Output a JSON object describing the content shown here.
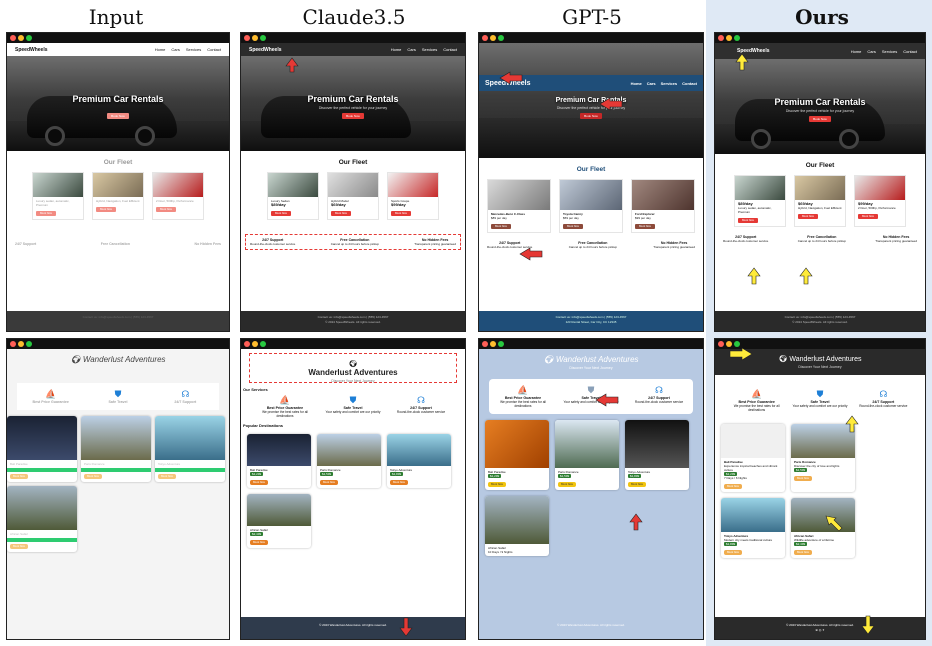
{
  "columns": [
    "Input",
    "Claude3.5",
    "GPT-5",
    "Ours"
  ],
  "car_site": {
    "brand": "SpeedWheels",
    "nav": [
      "Home",
      "Cars",
      "Services",
      "Contact"
    ],
    "hero_title": "Premium Car Rentals",
    "hero_sub": "Discover the perfect vehicle for your journey",
    "hero_cta": "Book Now",
    "fleet_title": "Our Fleet",
    "cars": [
      {
        "name": "Luxury Sedan",
        "price": "$89/day",
        "desc": "Luxury sedan, automatic, Premium",
        "button": "Book Now"
      },
      {
        "name": "Hybrid Model",
        "price": "$69/day",
        "desc": "Hybrid, Navigation, Fuel Efficient",
        "button": "Book Now"
      },
      {
        "name": "Sports Coupe",
        "price": "$99/day",
        "desc": "2 Door, 500hp, Performance",
        "button": "Book Now"
      }
    ],
    "gpt_cars": [
      {
        "name": "Mercedes-Benz C-Class",
        "price": "$89 per day",
        "desc": "Luxury sedan, automatic transmission, premium sound system",
        "button": "Book Now"
      },
      {
        "name": "Toyota Camry",
        "price": "$59 per day",
        "desc": "Midsize sedan, hybrid, navigation system",
        "button": "Book Now"
      },
      {
        "name": "Ford Explorer",
        "price": "$99 per day",
        "desc": "Seven seater, spacious, great for families",
        "button": "Book Now"
      }
    ],
    "features": [
      {
        "title": "24/7 Support",
        "text": "Round-the-clock customer service"
      },
      {
        "title": "Free Cancellation",
        "text": "Cancel up to 24 hours before pickup"
      },
      {
        "title": "No Hidden Fees",
        "text": "Transparent pricing guaranteed"
      }
    ],
    "footer": [
      "Contact us: info@speedwheels.com | (555) 123-4567",
      "123 Rental Street, Car City, CC 12345",
      "© 2024 SpeedWheels. All rights reserved."
    ]
  },
  "travel_site": {
    "title": "Wanderlust Adventures",
    "subtitle": "Discover Your Next Journey",
    "services_heading": "Our Services",
    "services": [
      {
        "icon": "⛵",
        "title": "Best Price Guarantee",
        "text": "We promise the best rates for all destinations"
      },
      {
        "icon": "⛊",
        "title": "Safe Travel",
        "text": "Your safety and comfort are our priority"
      },
      {
        "icon": "☊",
        "title": "24/7 Support",
        "text": "Round-the-clock customer service"
      }
    ],
    "destinations_heading": "Popular Destinations",
    "destinations": [
      {
        "name": "Bali Paradise",
        "desc": "Experience tropical beaches and vibrant culture",
        "price": "$1,299",
        "duration": "7 Days / 6 Nights",
        "button": "Book Now"
      },
      {
        "name": "Paris Romance",
        "desc": "Discover the city of love and lights",
        "price": "$1,599",
        "duration": "5 Days / 4 Nights",
        "button": "Book Now"
      },
      {
        "name": "Tokyo Adventure",
        "desc": "Modern city meets traditional culture",
        "price": "$1,899",
        "duration": "6 Days / 5 Nights",
        "button": "Book Now"
      },
      {
        "name": "African Safari",
        "desc": "Wildlife adventure of a lifetime",
        "price": "$2,499",
        "duration": "10 Days / 9 Nights",
        "button": "Book Now"
      }
    ],
    "footer": "© 2023 Wanderlust Adventures. All rights reserved."
  },
  "colors": {
    "red_accent": "#e53935",
    "blue_accent": "#1e7fd6",
    "gpt_nav": "#1f4e79",
    "ours_bg": "#dfe9f5",
    "travel_gpt_bg": "#b7c9e2"
  }
}
